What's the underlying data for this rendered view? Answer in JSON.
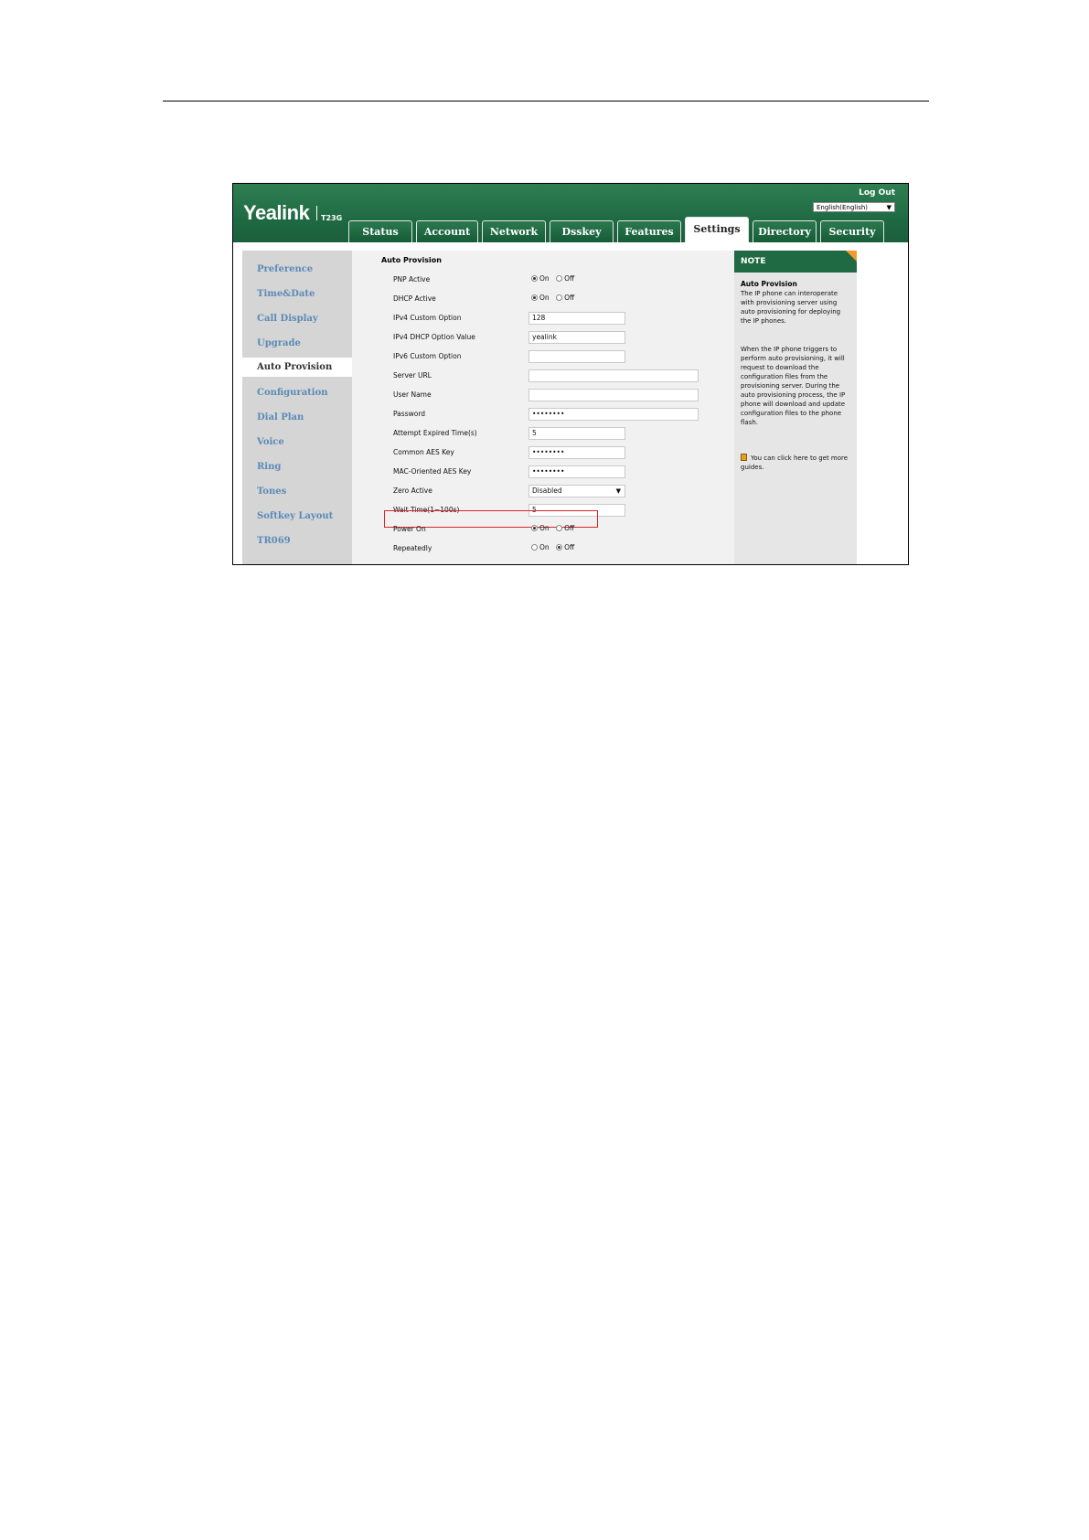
{
  "header": {
    "logo": "Yealink",
    "model": "T23G",
    "logout_label": "Log Out",
    "language": "English(English)"
  },
  "tabs": [
    "Status",
    "Account",
    "Network",
    "Dsskey",
    "Features",
    "Settings",
    "Directory",
    "Security"
  ],
  "active_tab": "Settings",
  "sidebar": {
    "items": [
      "Preference",
      "Time&Date",
      "Call Display",
      "Upgrade",
      "Auto Provision",
      "Configuration",
      "Dial Plan",
      "Voice",
      "Ring",
      "Tones",
      "Softkey Layout",
      "TR069"
    ],
    "active": "Auto Provision"
  },
  "main": {
    "section_title": "Auto Provision",
    "rows": [
      {
        "label": "PNP Active",
        "type": "radio",
        "on": "On",
        "off": "Off",
        "value": "On"
      },
      {
        "label": "DHCP Active",
        "type": "radio",
        "on": "On",
        "off": "Off",
        "value": "On"
      },
      {
        "label": "IPv4 Custom Option",
        "type": "text",
        "value": "128"
      },
      {
        "label": "IPv4 DHCP Option Value",
        "type": "text",
        "value": "yealink"
      },
      {
        "label": "IPv6 Custom Option",
        "type": "text",
        "value": ""
      },
      {
        "label": "Server URL",
        "type": "text",
        "value": ""
      },
      {
        "label": "User Name",
        "type": "text",
        "value": ""
      },
      {
        "label": "Password",
        "type": "password",
        "value": "••••••••"
      },
      {
        "label": "Attempt Expired Time(s)",
        "type": "text",
        "value": "5"
      },
      {
        "label": "Common AES Key",
        "type": "password",
        "value": "••••••••"
      },
      {
        "label": "MAC-Oriented AES Key",
        "type": "password",
        "value": "••••••••"
      },
      {
        "label": "Zero Active",
        "type": "select",
        "value": "Disabled"
      },
      {
        "label": "Wait Time(1~100s)",
        "type": "text",
        "value": "5"
      },
      {
        "label": "Power On",
        "type": "radio",
        "on": "On",
        "off": "Off",
        "value": "On"
      },
      {
        "label": "Repeatedly",
        "type": "radio",
        "on": "On",
        "off": "Off",
        "value": "Off"
      }
    ]
  },
  "note": {
    "header": "NOTE",
    "title": "Auto Provision",
    "para1": "The IP phone can interoperate with provisioning server using auto provisioning for deploying the IP phones.",
    "para2": "When the IP phone triggers to perform auto provisioning, it will request to download the configuration files from the provisioning server. During the auto provisioning process, the IP phone will download and update configuration files to the phone flash.",
    "guide": "You can click here to get more guides."
  },
  "colors": {
    "header_green": "#1f6a43",
    "nav_link": "#5a8ab8",
    "highlight_red": "#d62828",
    "note_corner": "#f39a2d"
  }
}
